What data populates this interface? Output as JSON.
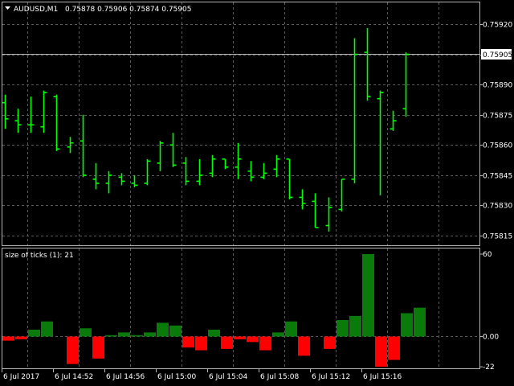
{
  "header": {
    "symbol": "AUDUSD,M1",
    "ohlc": "0.75878 0.75906 0.75874 0.75905"
  },
  "price_axis": {
    "labels": [
      "0.75920",
      "0.75905",
      "0.75890",
      "0.75875",
      "0.75860",
      "0.75845",
      "0.75830",
      "0.75815"
    ],
    "current_price": "0.75905"
  },
  "indicator": {
    "title": "size of ticks (1):  21",
    "axis_labels": [
      "60",
      "0.00",
      "-22"
    ]
  },
  "time_axis": {
    "labels": [
      "6 Jul 2017",
      "6 Jul 14:52",
      "6 Jul 14:56",
      "6 Jul 15:00",
      "6 Jul 15:04",
      "6 Jul 15:08",
      "6 Jul 15:12",
      "6 Jul 15:16"
    ]
  },
  "colors": {
    "background": "#000000",
    "bar": "#00ff00",
    "grid": "#5a5a5a",
    "hist_up": "#0a7a0a",
    "hist_down": "#ff0000",
    "frame": "#b4b4b4"
  },
  "chart_data": [
    {
      "type": "ohlc",
      "title": "",
      "ylim": [
        0.7581,
        0.75928
      ],
      "ohlc": [
        [
          0.75881,
          0.75885,
          0.75868,
          0.75873
        ],
        [
          0.75872,
          0.75878,
          0.75866,
          0.7587
        ],
        [
          0.7587,
          0.75884,
          0.75866,
          0.7587
        ],
        [
          0.75869,
          0.75887,
          0.75866,
          0.75886
        ],
        [
          0.75884,
          0.75885,
          0.75857,
          0.75858
        ],
        [
          0.75859,
          0.75864,
          0.75856,
          0.75861
        ],
        [
          0.75862,
          0.75875,
          0.75844,
          0.75845
        ],
        [
          0.75843,
          0.75851,
          0.75838,
          0.75841
        ],
        [
          0.75841,
          0.75847,
          0.75836,
          0.75845
        ],
        [
          0.75844,
          0.75846,
          0.7584,
          0.75842
        ],
        [
          0.75841,
          0.75845,
          0.75839,
          0.7584
        ],
        [
          0.75841,
          0.75853,
          0.7584,
          0.75852
        ],
        [
          0.75851,
          0.75862,
          0.75847,
          0.75861
        ],
        [
          0.7586,
          0.75866,
          0.75849,
          0.7585
        ],
        [
          0.75851,
          0.75854,
          0.7584,
          0.75842
        ],
        [
          0.75842,
          0.75853,
          0.7584,
          0.75845
        ],
        [
          0.75846,
          0.75855,
          0.75844,
          0.75853
        ],
        [
          0.75853,
          0.75853,
          0.75848,
          0.75849
        ],
        [
          0.75849,
          0.75861,
          0.75843,
          0.75853
        ],
        [
          0.75847,
          0.75852,
          0.75842,
          0.75844
        ],
        [
          0.75844,
          0.75851,
          0.75843,
          0.75846
        ],
        [
          0.75848,
          0.75855,
          0.75844,
          0.75853
        ],
        [
          0.75853,
          0.75853,
          0.75833,
          0.75834
        ],
        [
          0.75834,
          0.75838,
          0.75828,
          0.75831
        ],
        [
          0.75832,
          0.75836,
          0.75819,
          0.75819
        ],
        [
          0.7582,
          0.75834,
          0.75817,
          0.75829
        ],
        [
          0.75828,
          0.75843,
          0.75827,
          0.75843
        ],
        [
          0.75843,
          0.75913,
          0.75841,
          0.75905
        ],
        [
          0.75906,
          0.75918,
          0.75882,
          0.75884
        ],
        [
          0.75883,
          0.75887,
          0.75835,
          0.75886
        ],
        [
          0.75868,
          0.75877,
          0.75867,
          0.75872
        ],
        [
          0.75878,
          0.75906,
          0.75874,
          0.75905
        ]
      ]
    },
    {
      "type": "bar",
      "title": "size of ticks (1):  21",
      "ylim": [
        -22,
        60
      ],
      "values": [
        -3,
        -2,
        5,
        11,
        0,
        -20,
        6,
        -16,
        1,
        3,
        1,
        3,
        10,
        8,
        -8,
        -10,
        5,
        -9,
        -2,
        -4,
        -10,
        3,
        11,
        -14,
        0,
        -9,
        12,
        15,
        60,
        -22,
        -17,
        17,
        21
      ]
    }
  ]
}
